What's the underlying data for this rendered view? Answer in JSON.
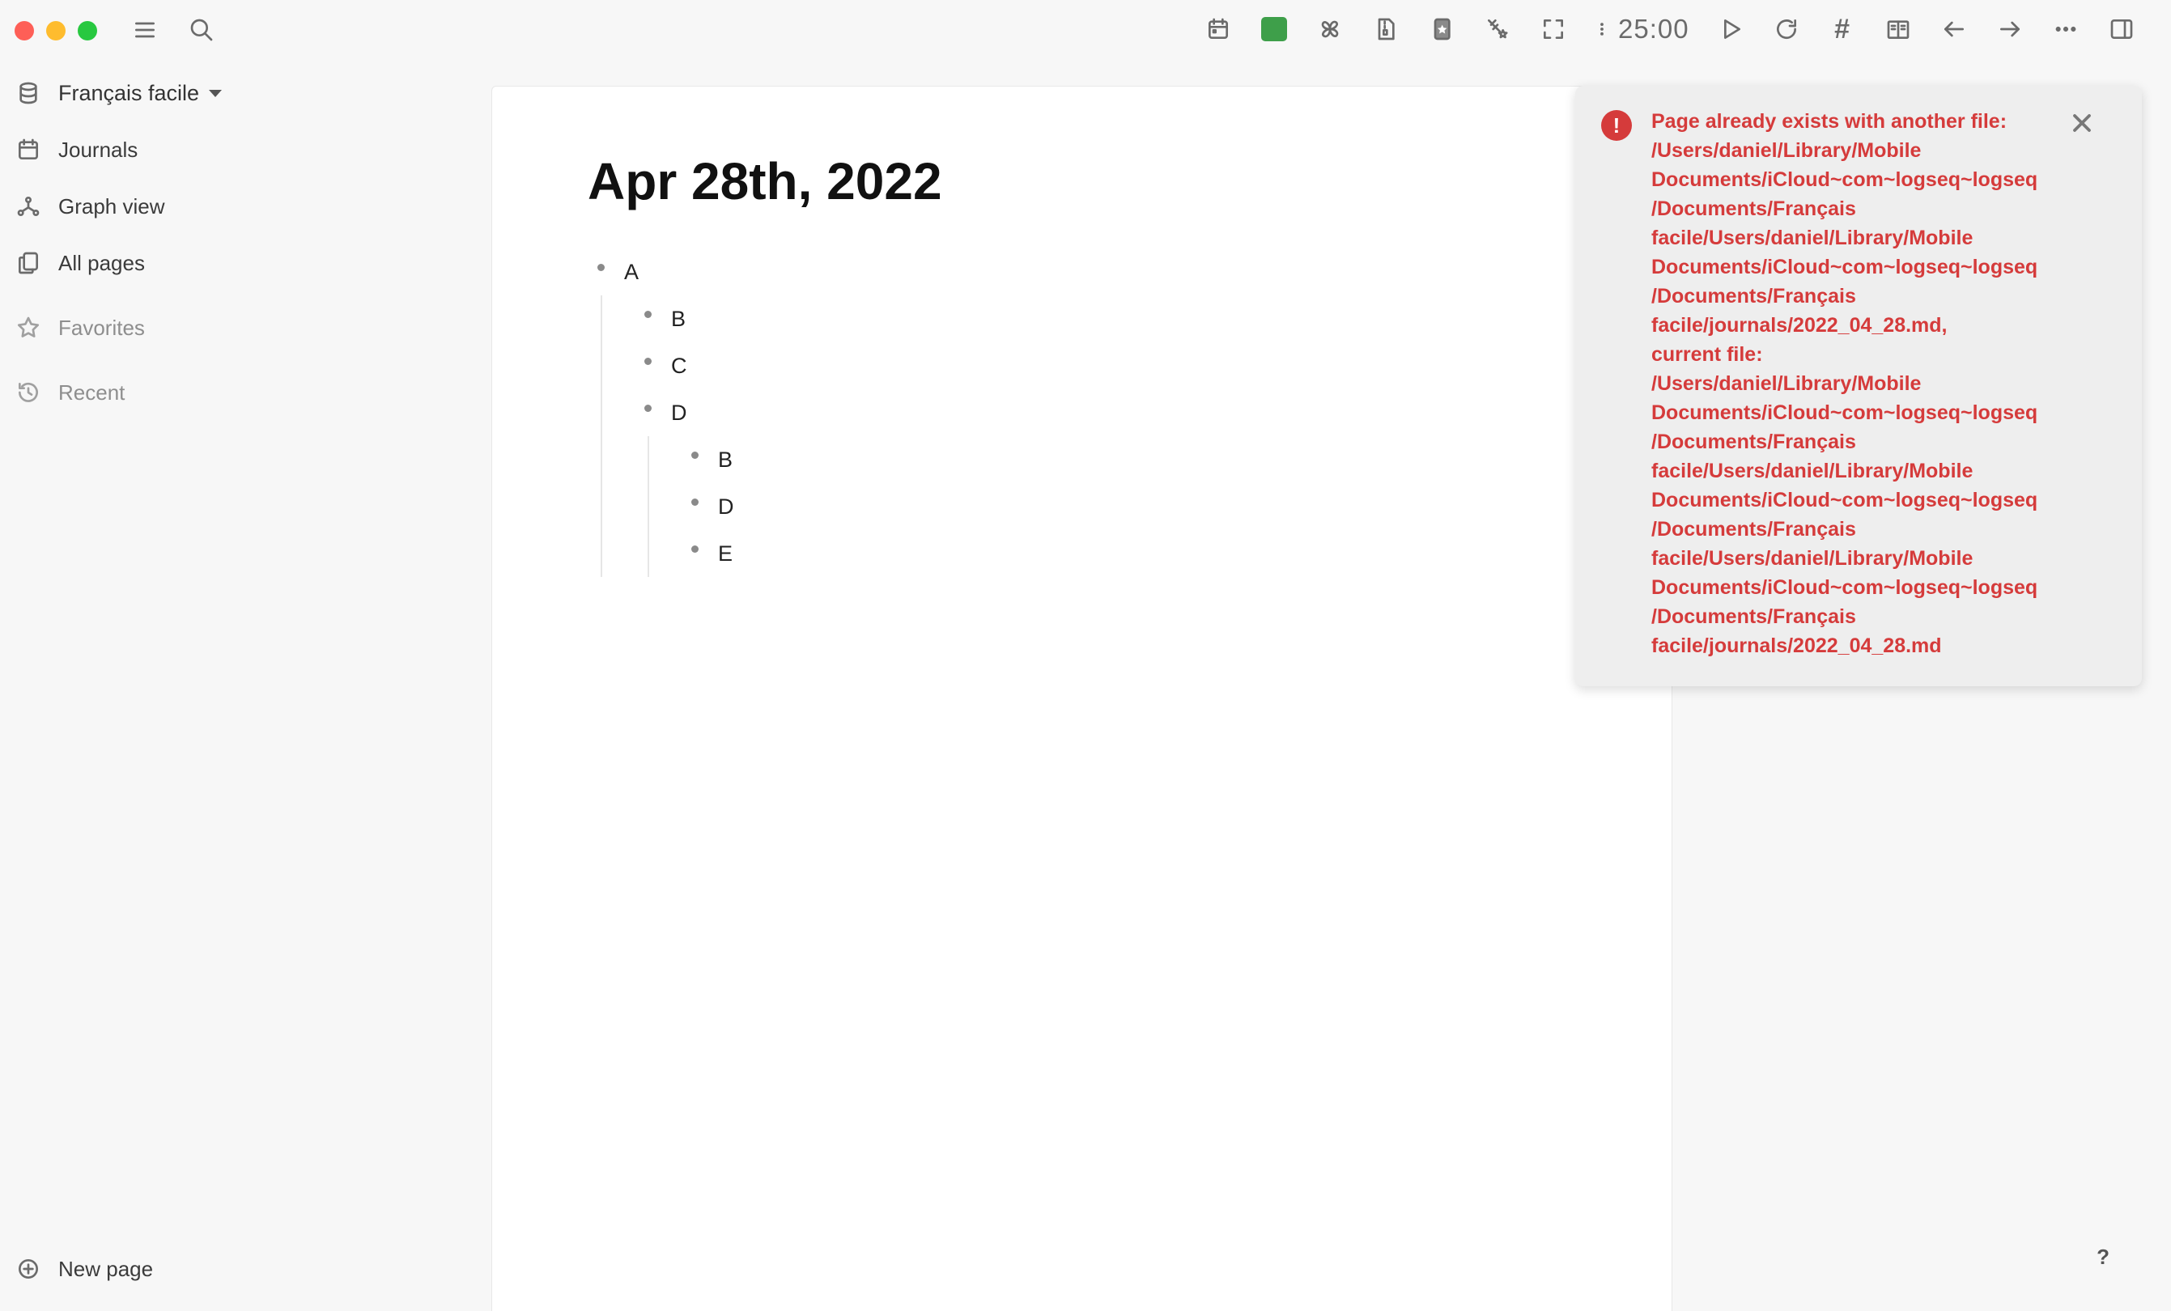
{
  "topbar": {
    "timer": "25:00",
    "hash_label": "#"
  },
  "sidebar": {
    "graph_name": "Français facile",
    "items": [
      {
        "label": "Journals"
      },
      {
        "label": "Graph view"
      },
      {
        "label": "All pages"
      }
    ],
    "favorites_label": "Favorites",
    "recent_label": "Recent",
    "new_page_label": "New page"
  },
  "page": {
    "title": "Apr 28th, 2022",
    "blocks": {
      "a": "A",
      "b": "B",
      "c": "C",
      "d": "D",
      "d_children": [
        "B",
        "D",
        "E"
      ]
    }
  },
  "toast": {
    "message": "Page already exists with another file:\n/Users/daniel/Library/Mobile\nDocuments/iCloud~com~logseq~logseq\n/Documents/Français\nfacile/Users/daniel/Library/Mobile\nDocuments/iCloud~com~logseq~logseq\n/Documents/Français\nfacile/journals/2022_04_28.md,\ncurrent file:\n/Users/daniel/Library/Mobile\nDocuments/iCloud~com~logseq~logseq\n/Documents/Français\nfacile/Users/daniel/Library/Mobile\nDocuments/iCloud~com~logseq~logseq\n/Documents/Français\nfacile/Users/daniel/Library/Mobile\nDocuments/iCloud~com~logseq~logseq\n/Documents/Français\nfacile/journals/2022_04_28.md"
  },
  "help_label": "?",
  "colors": {
    "error": "#d53b3b",
    "accent_green": "#3e9f4a"
  }
}
